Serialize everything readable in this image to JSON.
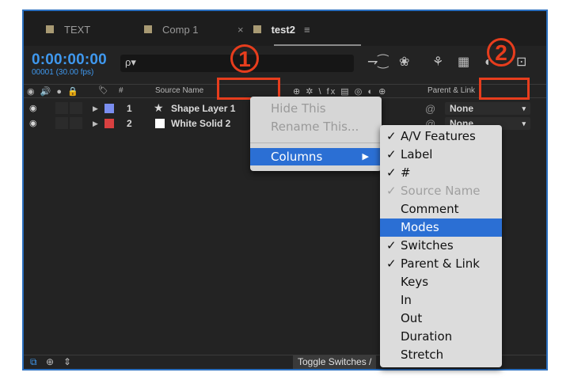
{
  "tabs": [
    {
      "label": "TEXT"
    },
    {
      "label": "Comp 1"
    },
    {
      "label": "test2",
      "close": "×",
      "menu": "≡"
    }
  ],
  "timecode": "0:00:00:00",
  "fps": "00001 (30.00 fps)",
  "search": {
    "icon": "ρ▾",
    "value": ""
  },
  "toolbar": {
    "draft3d": "⇁⁐",
    "shy": "❀",
    "frame_blend": "⚘",
    "motion_blur": "▦",
    "graph": "◐",
    "graph_editor": "⊡"
  },
  "columns": {
    "av_icons": "◉ 🔊 ● 🔒",
    "label_icon": "🏷",
    "number": "#",
    "source_name": "Source Name",
    "switch_icons": "⊕ ✲ \\ fx ▤ ◎ ◐ ⊕",
    "parent": "Parent & Link"
  },
  "layers": [
    {
      "eye": "◉",
      "twirl": "▶",
      "label_color": "#7b8ef0",
      "num": "1",
      "type_icon": "★",
      "name": "Shape Layer 1",
      "parent": "None",
      "chev": "▾",
      "pickwhip": "@"
    },
    {
      "eye": "◉",
      "twirl": "▶",
      "label_color": "#d94040",
      "num": "2",
      "type_icon": "",
      "name": "White Solid 2",
      "parent": "None",
      "chev": "▾",
      "pickwhip": "@"
    }
  ],
  "context_menu": {
    "hide_this": "Hide This",
    "rename_this": "Rename This...",
    "columns": "Columns",
    "arrow": "▶"
  },
  "columns_submenu": [
    {
      "label": "A/V Features",
      "checked": true
    },
    {
      "label": "Label",
      "checked": true
    },
    {
      "label": "#",
      "checked": true
    },
    {
      "label": "Source Name",
      "checked": true,
      "disabled": true
    },
    {
      "label": "Comment",
      "checked": false
    },
    {
      "label": "Modes",
      "checked": false,
      "highlighted": true
    },
    {
      "label": "Switches",
      "checked": true
    },
    {
      "label": "Parent & Link",
      "checked": true
    },
    {
      "label": "Keys",
      "checked": false
    },
    {
      "label": "In",
      "checked": false
    },
    {
      "label": "Out",
      "checked": false
    },
    {
      "label": "Duration",
      "checked": false
    },
    {
      "label": "Stretch",
      "checked": false
    }
  ],
  "check_glyph": "✓",
  "footer": {
    "icon1": "⧉",
    "icon2": "⊕",
    "icon3": "⇕",
    "toggle": "Toggle Switches / "
  },
  "callouts": {
    "one": "1",
    "two": "2"
  },
  "colors": {
    "accent": "#3f98ee",
    "highlight": "#2b6fd4",
    "callout": "#e73d1d"
  }
}
